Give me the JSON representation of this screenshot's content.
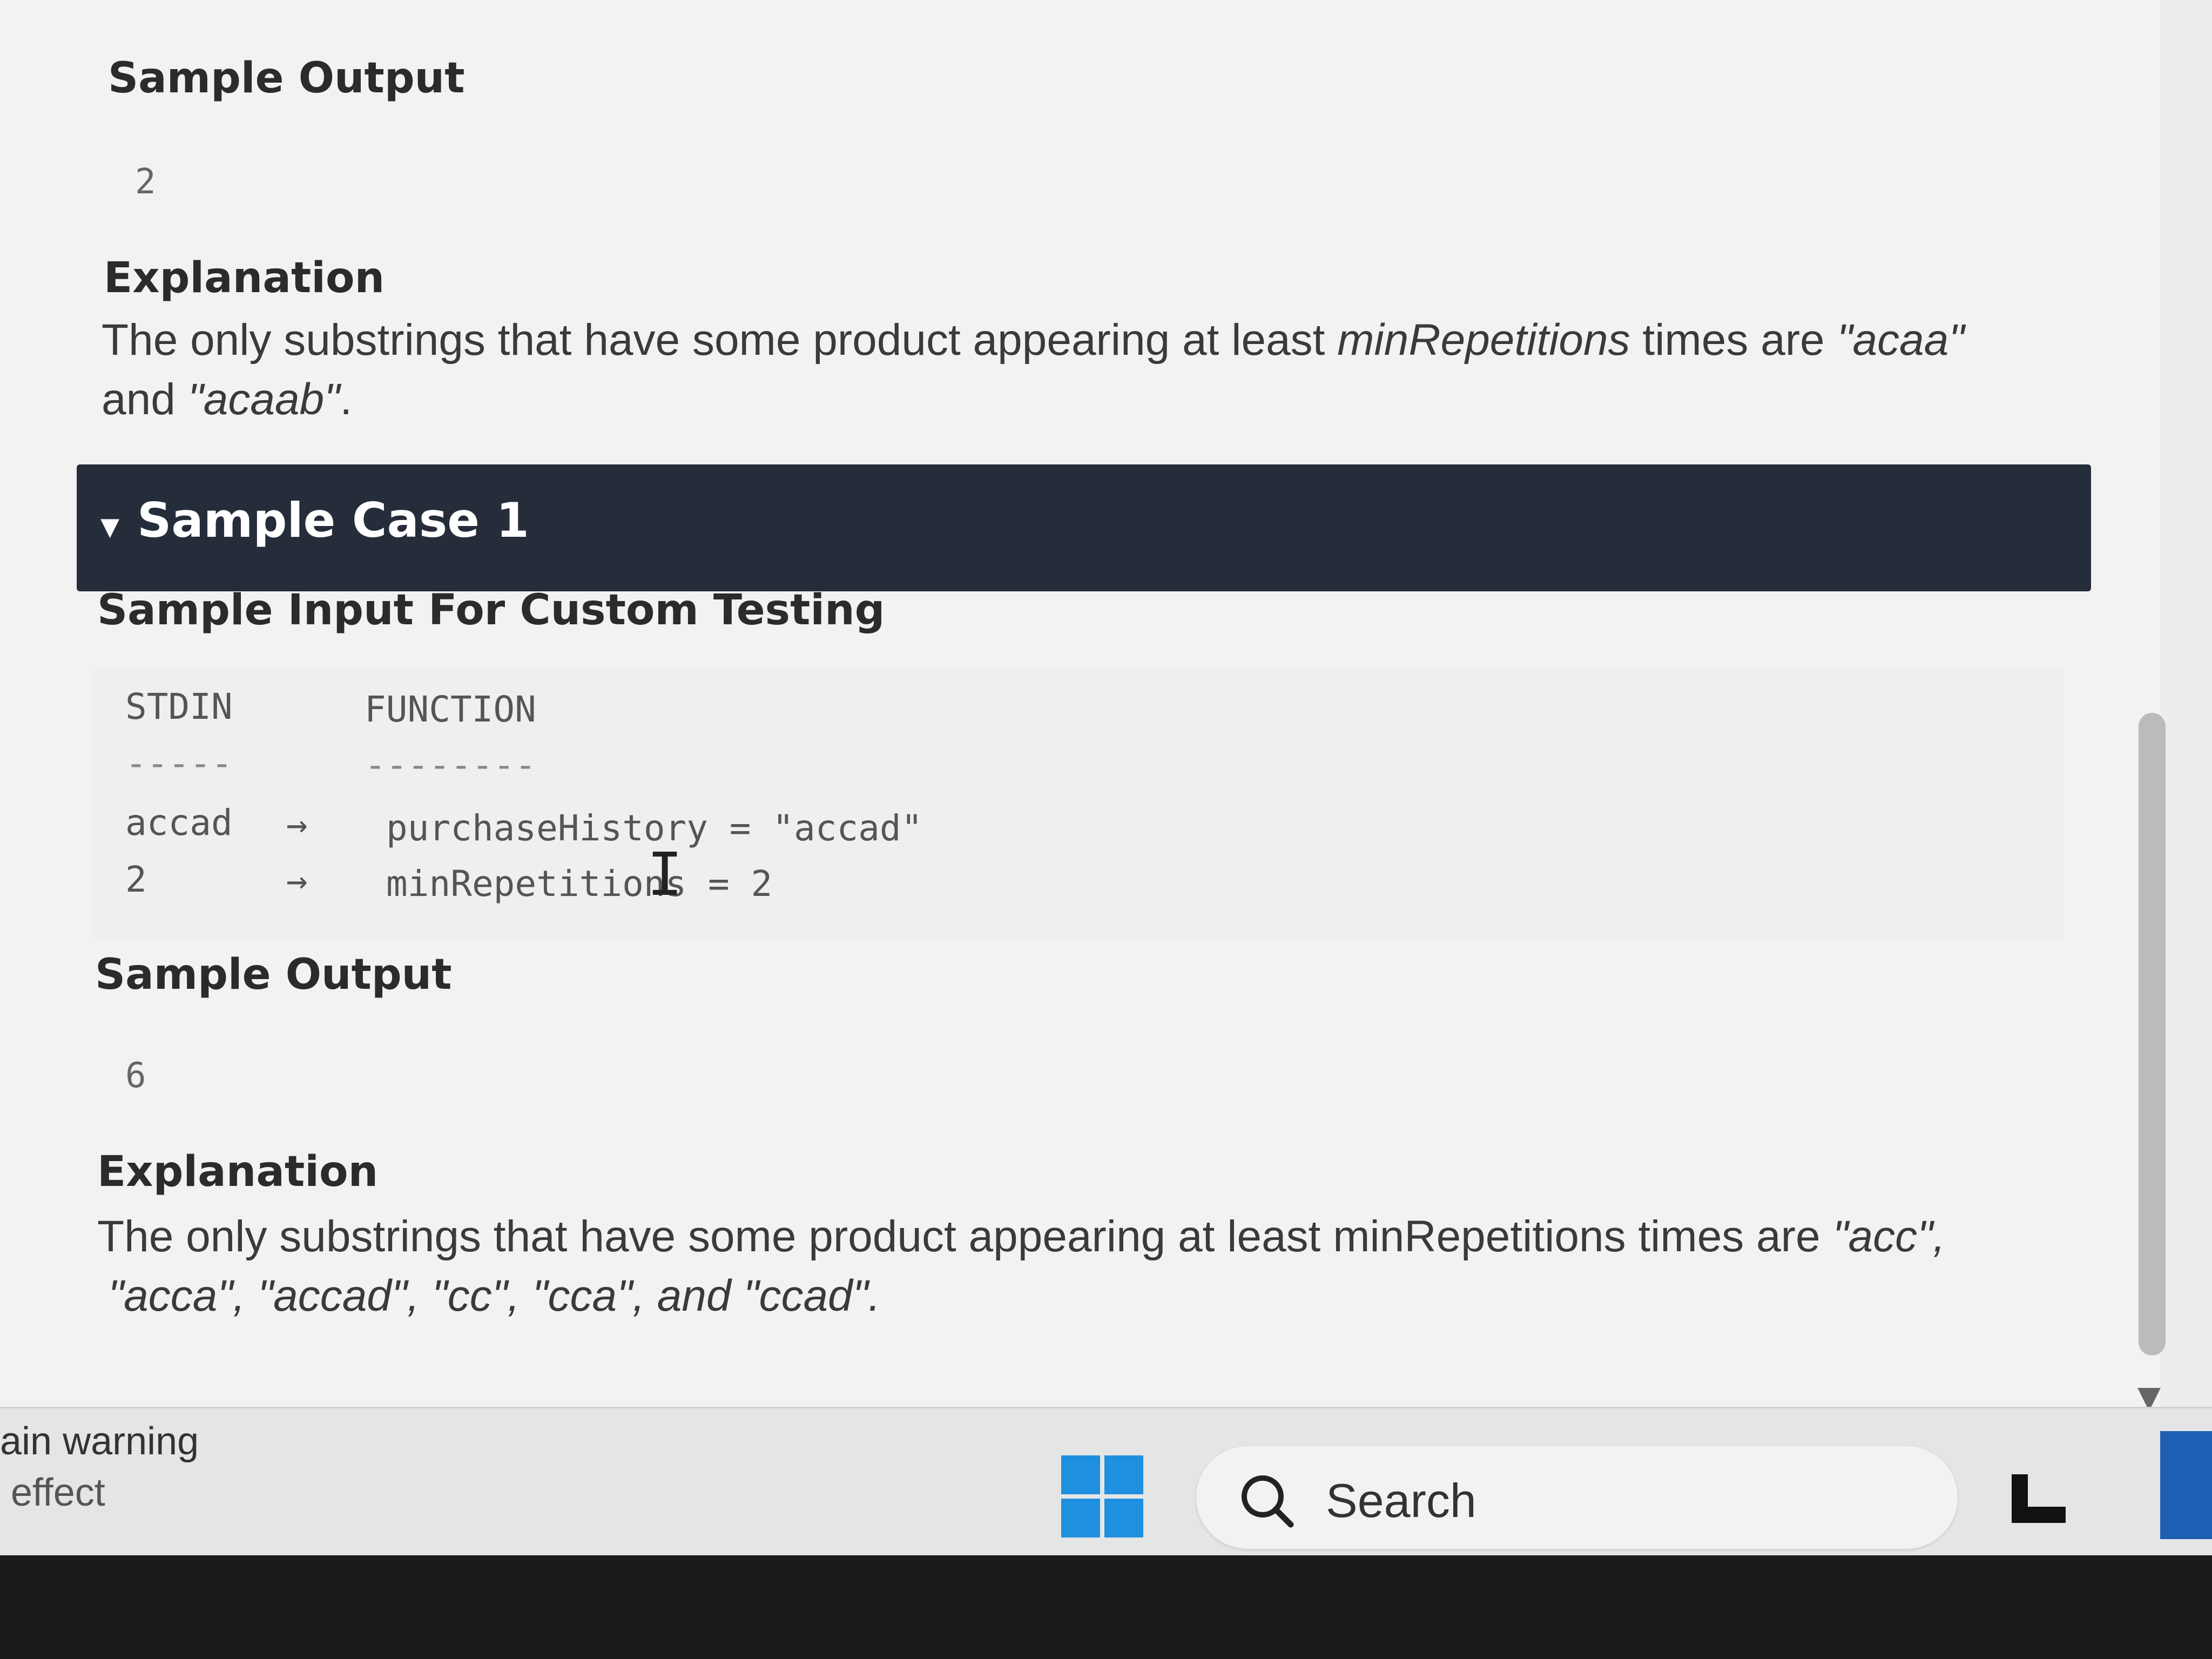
{
  "section0": {
    "output_heading": "Sample Output",
    "output_value": "2",
    "explanation_heading": "Explanation",
    "explanation_part1": "The only substrings that have some product appearing at least",
    "explanation_italic_var": "minRepetitions",
    "explanation_part2": "times are",
    "explanation_quote1": "\"acaa\"",
    "explanation_line2_prefix": "and",
    "explanation_quote2": "\"acaab\"",
    "explanation_line2_suffix": "."
  },
  "case1": {
    "banner_toggle": "▾",
    "banner_title": "Sample Case 1",
    "input_heading": "Sample Input For Custom Testing",
    "columns": [
      "STDIN",
      "FUNCTION"
    ],
    "separators": [
      "-----",
      "--------"
    ],
    "rows": [
      {
        "stdin": "accad",
        "arrow": "→",
        "function": "purchaseHistory = \"accad\""
      },
      {
        "stdin": "2",
        "arrow": "→",
        "function": "minRepetitions = 2"
      }
    ],
    "output_heading": "Sample Output",
    "output_value": "6",
    "explanation_heading": "Explanation",
    "explanation_line1_text": "The only substrings that have some product appearing at least  minRepetitions times are",
    "explanation_line1_quote": "\"acc\",",
    "explanation_line2": "\"acca\", \"accad\", \"cc\", \"cca\", and \"ccad\"."
  },
  "notification": {
    "line1": "ain warning",
    "line2": "effect"
  },
  "taskbar": {
    "search_label": "Search"
  },
  "colors": {
    "banner_bg": "#262d3a",
    "windows_blue": "#1f8fe0"
  }
}
